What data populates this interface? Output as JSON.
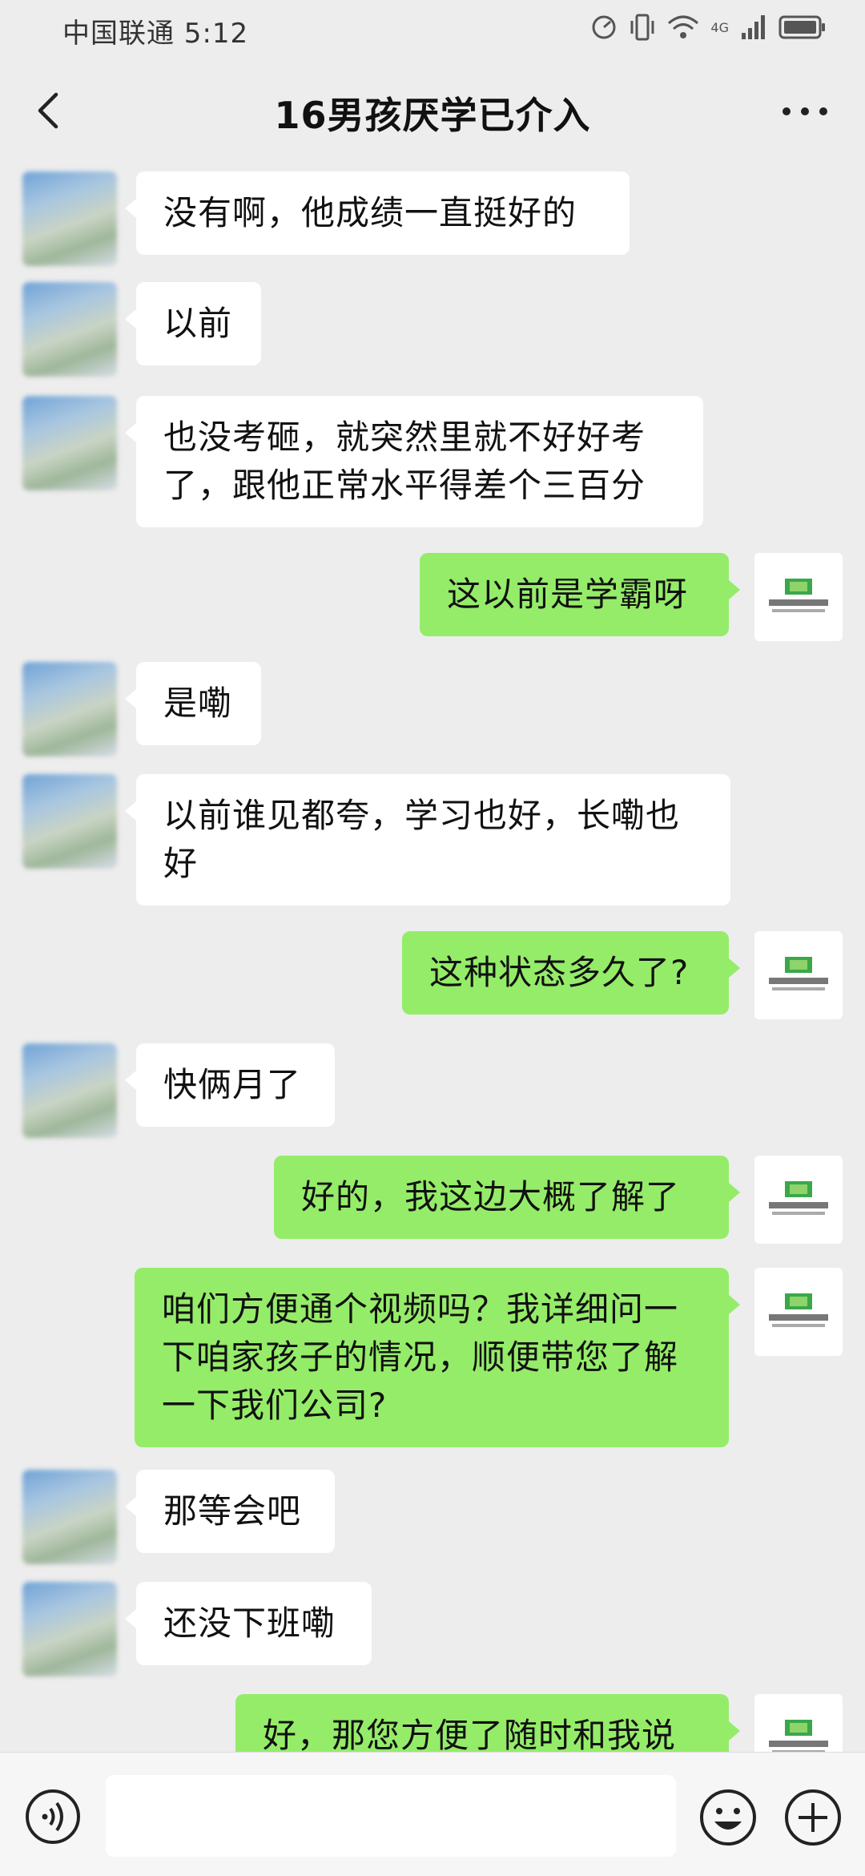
{
  "status_bar": {
    "carrier": "中国联通 5:12",
    "network": "4G"
  },
  "header": {
    "title": "16男孩厌学已介入"
  },
  "messages": [
    {
      "side": "in",
      "text": "没有啊，他成绩一直挺好的"
    },
    {
      "side": "in",
      "text": "以前"
    },
    {
      "side": "in",
      "text": "也没考砸，就突然里就不好好考了，跟他正常水平得差个三百分"
    },
    {
      "side": "out",
      "text": "这以前是学霸呀"
    },
    {
      "side": "in",
      "text": "是嘞"
    },
    {
      "side": "in",
      "text": "以前谁见都夸，学习也好，长嘞也好"
    },
    {
      "side": "out",
      "text": "这种状态多久了?"
    },
    {
      "side": "in",
      "text": "快俩月了"
    },
    {
      "side": "out",
      "text": "好的，我这边大概了解了"
    },
    {
      "side": "out",
      "text": "咱们方便通个视频吗？我详细问一下咱家孩子的情况，顺便带您了解一下我们公司?"
    },
    {
      "side": "in",
      "text": "那等会吧"
    },
    {
      "side": "in",
      "text": "还没下班嘞"
    },
    {
      "side": "out",
      "text": "好，那您方便了随时和我说"
    }
  ],
  "input_bar": {
    "placeholder": ""
  },
  "colors": {
    "outgoing_bubble": "#95ec69",
    "incoming_bubble": "#ffffff",
    "background": "#ededed",
    "logo_green": "#3aa84a"
  },
  "icons": [
    "back-icon",
    "more-icon",
    "voice-icon",
    "emoji-icon",
    "plus-icon"
  ]
}
